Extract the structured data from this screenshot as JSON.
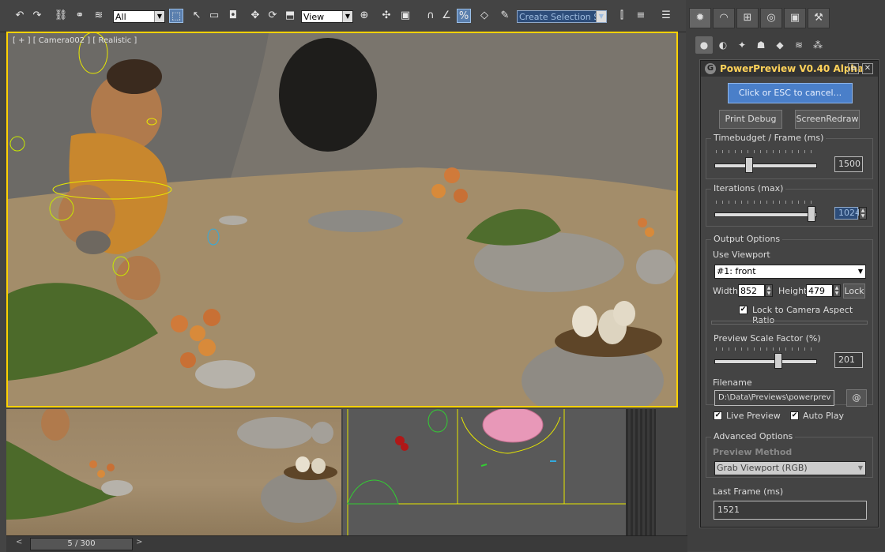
{
  "toolbar": {
    "selection_filter": "All",
    "reference_coord": "View",
    "named_selection_placeholder": "Create Selection Se"
  },
  "viewport_main": {
    "label": "[ + ] [ Camera002 ] [ Realistic ]"
  },
  "timeline": {
    "frame_counter": "5 / 300"
  },
  "dialog": {
    "title": "PowerPreview V0.40 Alpha",
    "cancel_button": "Click or ESC to cancel...",
    "print_debug_button": "Print Debug",
    "screen_redraw_button": "ScreenRedraw",
    "timebudget": {
      "title": "Timebudget / Frame (ms)",
      "value": "1500",
      "slider_position": 0.33
    },
    "iterations": {
      "title": "Iterations (max)",
      "value": "1024",
      "slider_position": 1.0
    },
    "output_options": {
      "title": "Output Options",
      "use_viewport_label": "Use Viewport",
      "viewport_value": "#1: front",
      "width_label": "Width",
      "width_value": "852",
      "height_label": "Height",
      "height_value": "479",
      "lock_button": "Lock",
      "lock_aspect_label": "Lock to Camera Aspect Ratio",
      "lock_aspect_checked": true
    },
    "preview_scale": {
      "title": "Preview Scale Factor (%)",
      "value": "201",
      "slider_position": 0.64
    },
    "filename": {
      "label": "Filename",
      "value": "D:\\Data\\Previews\\powerprev",
      "browse_button": "@"
    },
    "live_preview_label": "Live Preview",
    "live_preview_checked": true,
    "auto_play_label": "Auto Play",
    "auto_play_checked": true,
    "advanced_options": {
      "title": "Advanced Options",
      "preview_method_label": "Preview Method",
      "preview_method_value": "Grab Viewport (RGB)"
    },
    "last_frame": {
      "title": "Last Frame (ms)",
      "value": "1521"
    }
  },
  "colors": {
    "viewport_border": "#ffd200",
    "dialog_title": "#ffd25a",
    "cancel_button": "#4a7fc9"
  }
}
